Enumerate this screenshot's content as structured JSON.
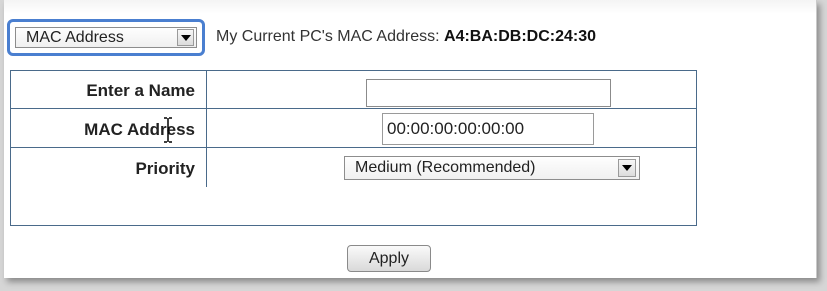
{
  "mode_select": {
    "selected": "MAC Address"
  },
  "current_mac": {
    "label": "My Current PC's MAC Address:",
    "value": "A4:BA:DB:DC:24:30"
  },
  "form": {
    "name": {
      "label": "Enter a Name",
      "value": ""
    },
    "mac": {
      "label": "MAC Address",
      "value": "00:00:00:00:00:00"
    },
    "priority": {
      "label": "Priority",
      "selected": "Medium (Recommended)"
    }
  },
  "apply_label": "Apply",
  "colors": {
    "highlight": "#4a7fd0",
    "table_border": "#4a6a8a"
  },
  "icons": [
    "chevron-down-icon",
    "text-cursor-icon"
  ]
}
